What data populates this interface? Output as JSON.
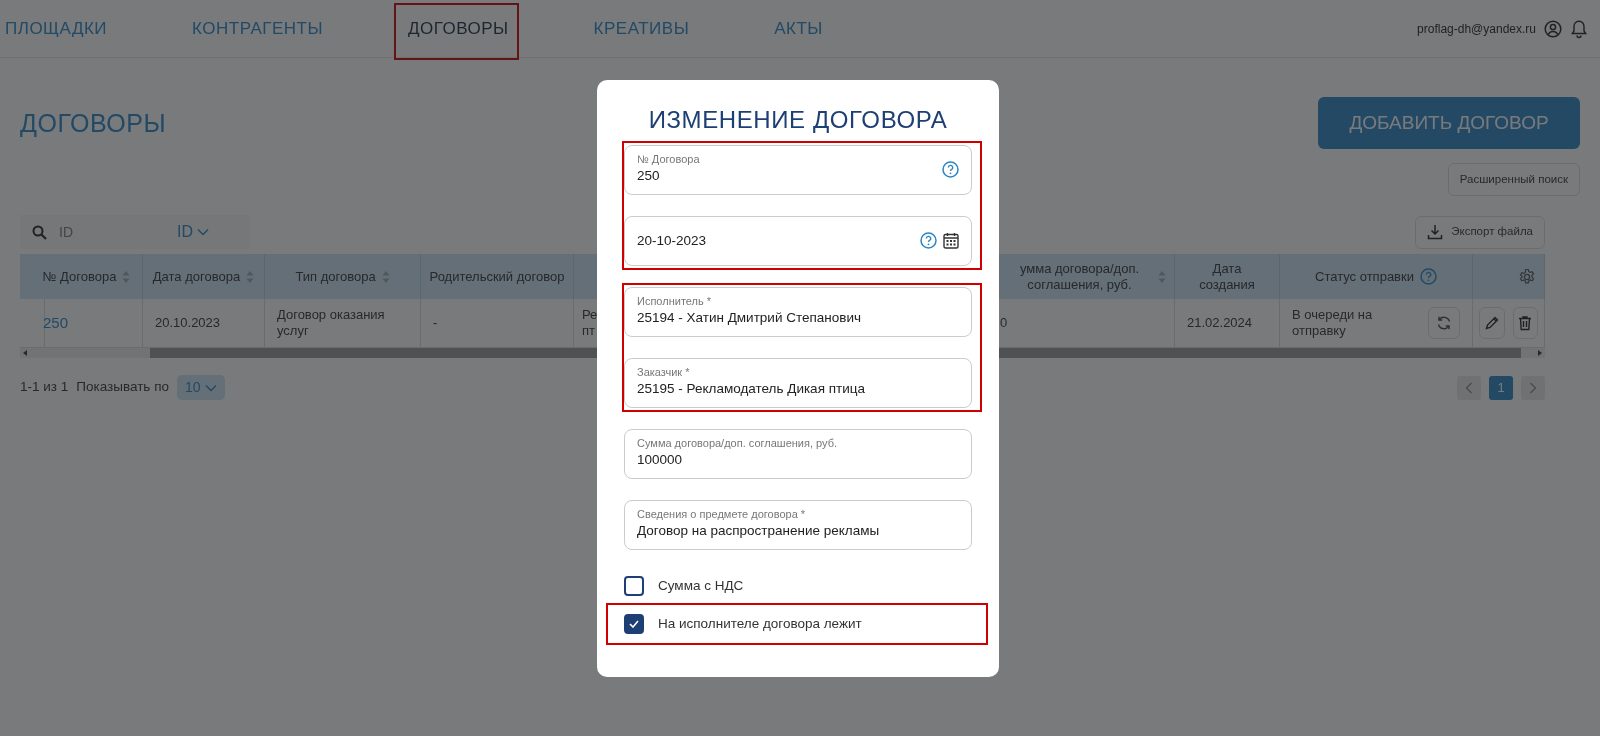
{
  "nav": {
    "items": [
      {
        "label": "ПЛОЩАДКИ",
        "selected": false,
        "highlighted": false
      },
      {
        "label": "КОНТРАГЕНТЫ",
        "selected": false,
        "highlighted": false
      },
      {
        "label": "ДОГОВОРЫ",
        "selected": true,
        "highlighted": true
      },
      {
        "label": "КРЕАТИВЫ",
        "selected": false,
        "highlighted": false
      },
      {
        "label": "АКТЫ",
        "selected": false,
        "highlighted": false
      }
    ],
    "user_email": "proflag-dh@yandex.ru"
  },
  "page": {
    "title": "ДОГОВОРЫ",
    "add_button": "ДОБАВИТЬ ДОГОВОР",
    "advanced_search_button": "Расширенный поиск",
    "export_button": "Экспорт файла",
    "search": {
      "placeholder": "ID",
      "filter": "ID"
    }
  },
  "table": {
    "columns": [
      {
        "label": "№ Договора",
        "sortable": true,
        "help": false
      },
      {
        "label": "Дата договора",
        "sortable": true,
        "help": false
      },
      {
        "label": "Тип договора",
        "sortable": true,
        "help": false
      },
      {
        "label": "Родительский договор",
        "sortable": false,
        "help": false
      },
      {},
      {
        "label": "умма договора/доп. соглашения, руб.",
        "sortable": true,
        "help": false
      },
      {
        "label": "Дата создания",
        "sortable": false,
        "help": false
      },
      {
        "label": "Статус отправки",
        "sortable": false,
        "help": true
      },
      {
        "kind": "settings",
        "sortable": false,
        "help": false
      }
    ],
    "rows": [
      {
        "cells": [
          "250",
          "20.10.2023",
          "Договор оказания услуг",
          "-",
          "Ре пт",
          "0",
          "21.02.2024"
        ],
        "status": "В очереди на отправку"
      }
    ]
  },
  "pagination": {
    "summary": "1-1 из 1",
    "page_size_label": "Показывать по",
    "page_size": "10",
    "pages": [
      {
        "label": "1",
        "selected": true
      }
    ]
  },
  "modal": {
    "title": "ИЗМЕНЕНИЕ ДОГОВОРА",
    "groups": [
      {
        "highlighted": true,
        "fields": [
          {
            "label": "№ Договора",
            "value": "250",
            "help": true,
            "calendar": false
          },
          {
            "value": "20-10-2023",
            "help": true,
            "calendar": true
          }
        ]
      },
      {
        "highlighted": true,
        "fields": [
          {
            "label": "Исполнитель *",
            "value": "25194 - Хатин Дмитрий Степанович",
            "help": false,
            "calendar": false
          },
          {
            "label": "Заказчик *",
            "value": "25195 - Рекламодатель Дикая птица",
            "help": false,
            "calendar": false
          }
        ]
      },
      {
        "highlighted": false,
        "fields": [
          {
            "label": "Сумма договора/доп. соглашения, руб.",
            "value": "100000",
            "help": false,
            "calendar": false
          },
          {
            "label": "Сведения о предмете договора *",
            "value": "Договор на распространение рекламы",
            "help": false,
            "calendar": false
          }
        ]
      }
    ],
    "checkboxes": [
      {
        "label": "Сумма с НДС",
        "checked": false,
        "highlighted": false
      },
      {
        "label": "На исполнителе договора лежит",
        "checked": true,
        "highlighted": true
      }
    ]
  }
}
